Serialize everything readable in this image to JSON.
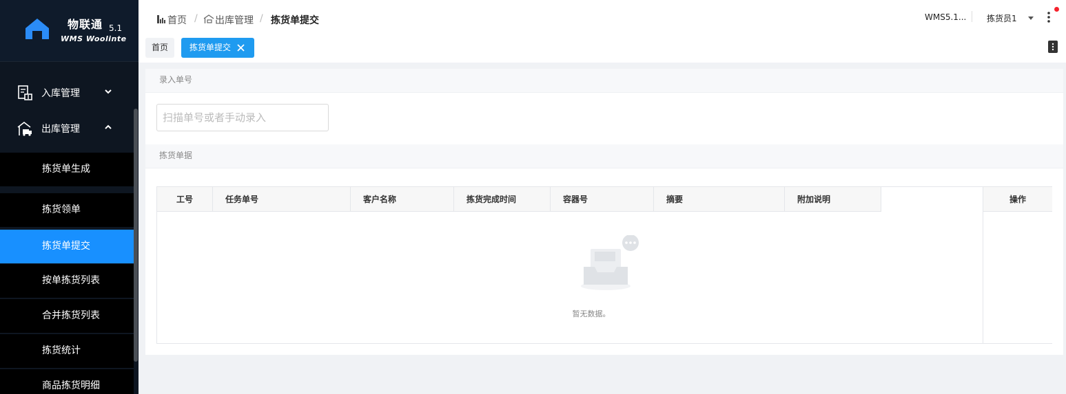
{
  "brand": {
    "name": "物联通",
    "version": "5.1",
    "subtitle": "WMS Woolinte"
  },
  "sidebar": {
    "groups": [
      {
        "label": "入库管理",
        "icon": "inbound-icon",
        "expanded": false
      },
      {
        "label": "出库管理",
        "icon": "outbound-icon",
        "expanded": true
      }
    ],
    "items": [
      {
        "label": "拣货单生成"
      },
      {
        "label": "拣货领单"
      },
      {
        "label": "拣货单提交",
        "active": true
      },
      {
        "label": "按单拣货列表"
      },
      {
        "label": "合并拣货列表"
      },
      {
        "label": "拣货统计"
      },
      {
        "label": "商品拣货明细"
      }
    ]
  },
  "header": {
    "breadcrumb": [
      "首页",
      "出库管理",
      "拣货单提交"
    ],
    "separator": "/",
    "warehouse": "WMS5.1...",
    "user": "拣货员1"
  },
  "tabs": [
    {
      "label": "首页"
    },
    {
      "label": "拣货单提交",
      "active": true
    }
  ],
  "main": {
    "section_entry": "录入单号",
    "scan_placeholder": "扫描单号或者手动录入",
    "section_orders": "拣货单据",
    "table": {
      "columns": [
        "工号",
        "任务单号",
        "客户名称",
        "拣货完成时间",
        "容器号",
        "摘要",
        "附加说明"
      ],
      "op_column": "操作",
      "empty_text": "暂无数据。"
    }
  },
  "colors": {
    "sidebar": "#0e1621",
    "accent": "#1890ff",
    "tab_active": "#1f9bf0",
    "notify_dot": "#f5222d"
  }
}
